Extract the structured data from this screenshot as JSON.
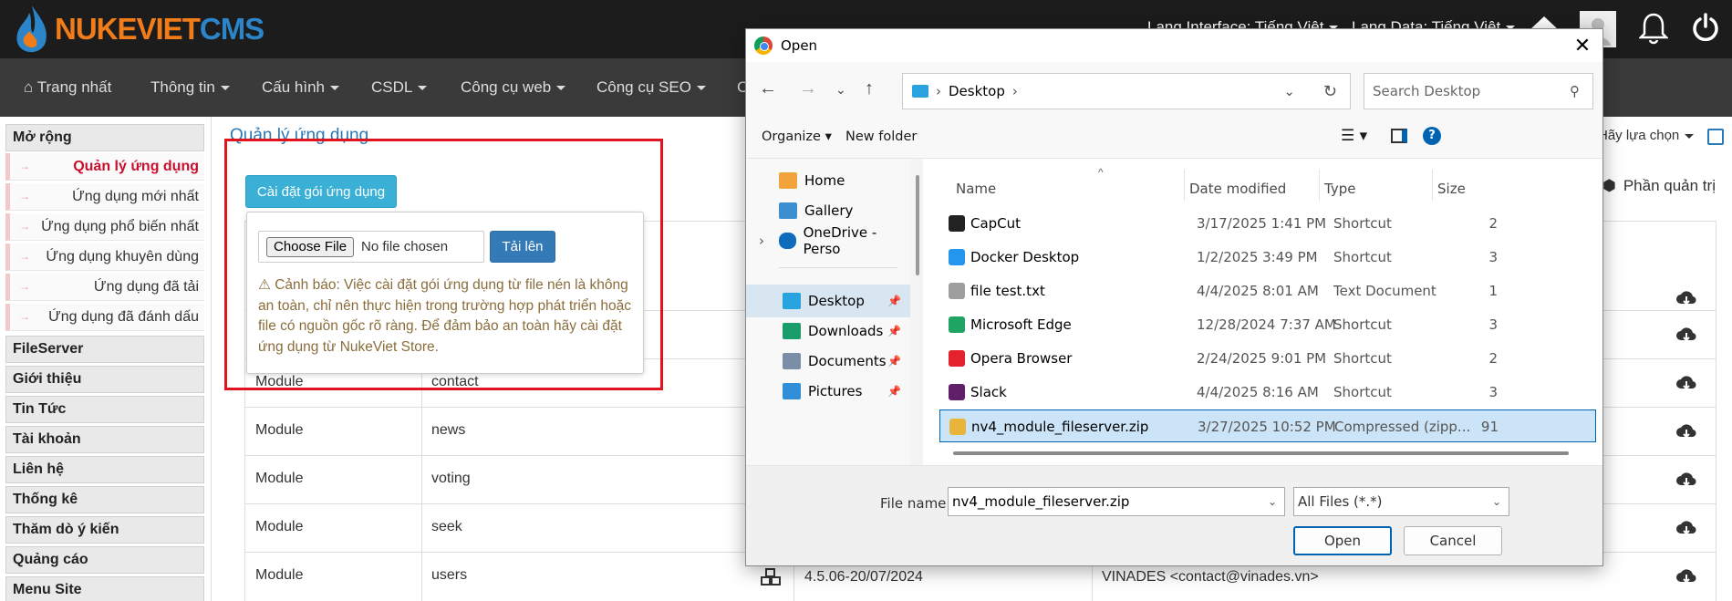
{
  "header": {
    "logo_a": "NUKEVIET",
    "logo_b": "CMS",
    "lang_interface": "Lang Interface: Tiếng Việt",
    "lang_data": "Lang Data: Tiếng Việt"
  },
  "menu": {
    "items": [
      {
        "label": "Trang nhất"
      },
      {
        "label": "Thông tin"
      },
      {
        "label": "Cấu hình"
      },
      {
        "label": "CSDL"
      },
      {
        "label": "Công cụ web"
      },
      {
        "label": "Công cụ SEO"
      },
      {
        "label": "C"
      }
    ]
  },
  "sidebar": {
    "section_title": "Mở rộng",
    "sub_items": [
      {
        "label": "Quản lý ứng dụng",
        "active": true
      },
      {
        "label": "Ứng dụng mới nhất"
      },
      {
        "label": "Ứng dụng phổ biến nhất"
      },
      {
        "label": "Ứng dụng khuyên dùng"
      },
      {
        "label": "Ứng dụng đã tải"
      },
      {
        "label": "Ứng dụng đã đánh dấu"
      }
    ],
    "modules": [
      {
        "label": "FileServer"
      },
      {
        "label": "Giới thiệu"
      },
      {
        "label": "Tin Tức"
      },
      {
        "label": "Tài khoản"
      },
      {
        "label": "Liên hệ"
      },
      {
        "label": "Thống kê"
      },
      {
        "label": "Thăm dò ý kiến"
      },
      {
        "label": "Quảng cáo"
      },
      {
        "label": "Menu Site"
      }
    ]
  },
  "main": {
    "page_title": "Quản lý ứng dụng",
    "install_button": "Cài đặt gói ứng dụng",
    "choose_file_button": "Choose File",
    "no_file_text": "No file chosen",
    "upload_button": "Tải lên",
    "warning_icon": "warning-triangle-icon",
    "warning_text": "Cảnh báo: Việc cài đặt gói ứng dụng từ file nén là không an toàn, chỉ nên thực hiện trong trường hợp phát triển hoặc file có nguồn gốc rõ ràng. Để đảm bảo an toàn hãy cài đặt ứng dụng từ NukeViet Store.",
    "right_select": "Hãy lựa chọn",
    "admin_label": "Phần quản trị",
    "rows": [
      {
        "type": "Module",
        "name": "contact"
      },
      {
        "type": "Module",
        "name": "news"
      },
      {
        "type": "Module",
        "name": "voting"
      },
      {
        "type": "Module",
        "name": "seek"
      },
      {
        "type": "Module",
        "name": "users",
        "version": "4.5.06-20/07/2024",
        "author": "VINADES <contact@vinades.vn>"
      }
    ]
  },
  "dialog": {
    "title": "Open",
    "breadcrumb": "Desktop",
    "search_placeholder": "Search Desktop",
    "organize": "Organize",
    "new_folder": "New folder",
    "nav_items": [
      {
        "label": "Home",
        "icon": "home-icon"
      },
      {
        "label": "Gallery",
        "icon": "gallery-icon"
      },
      {
        "label": "OneDrive - Perso",
        "icon": "onedrive-icon"
      },
      {
        "label": "Desktop",
        "icon": "desktop-icon",
        "selected": true
      },
      {
        "label": "Downloads",
        "icon": "download-icon"
      },
      {
        "label": "Documents",
        "icon": "documents-icon"
      },
      {
        "label": "Pictures",
        "icon": "pictures-icon"
      }
    ],
    "columns": {
      "name": "Name",
      "date": "Date modified",
      "type": "Type",
      "size": "Size"
    },
    "files": [
      {
        "name": "CapCut",
        "date": "3/17/2025 1:41 PM",
        "type": "Shortcut",
        "size": "2",
        "color": "#222222"
      },
      {
        "name": "Docker Desktop",
        "date": "1/2/2025 3:49 PM",
        "type": "Shortcut",
        "size": "3",
        "color": "#2496ed"
      },
      {
        "name": "file test.txt",
        "date": "4/4/2025 8:01 AM",
        "type": "Text Document",
        "size": "1",
        "color": "#9e9e9e"
      },
      {
        "name": "Microsoft Edge",
        "date": "12/28/2024 7:37 AM",
        "type": "Shortcut",
        "size": "3",
        "color": "#1fa463"
      },
      {
        "name": "Opera Browser",
        "date": "2/24/2025 9:01 PM",
        "type": "Shortcut",
        "size": "2",
        "color": "#e3222d"
      },
      {
        "name": "Slack",
        "date": "4/4/2025 8:16 AM",
        "type": "Shortcut",
        "size": "3",
        "color": "#611f69"
      },
      {
        "name": "nv4_module_fileserver.zip",
        "date": "3/27/2025 10:52 PM",
        "type": "Compressed (zipp...",
        "size": "91",
        "color": "#e8b43a",
        "selected": true
      }
    ],
    "file_name_label": "File name:",
    "file_name_value": "nv4_module_fileserver.zip",
    "filter": "All Files (*.*)",
    "open_button": "Open",
    "cancel_button": "Cancel"
  },
  "colors": {
    "highlight_box": "#e0141e",
    "info_button": "#3ab0d6",
    "primary_button": "#337ab7",
    "warning_text": "#8a6d3b"
  }
}
